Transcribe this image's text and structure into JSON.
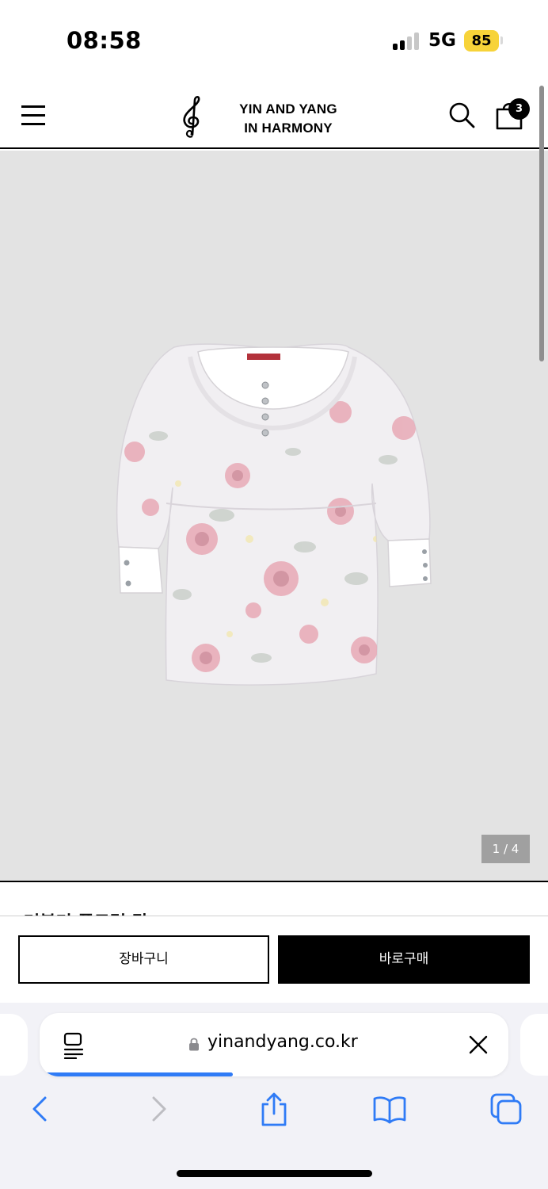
{
  "status_bar": {
    "time": "08:58",
    "network": "5G",
    "battery": "85",
    "battery_color": "#f7d339"
  },
  "header": {
    "menu_icon": "hamburger-icon",
    "logo_line1": "YIN AND YANG",
    "logo_line2": "IN HARMONY",
    "logo_icon": "treble-clef-icon",
    "search_icon": "search-icon",
    "cart_icon": "shopping-bag-icon",
    "cart_count": "3"
  },
  "gallery": {
    "background": "#e3e3e3",
    "image": "floral-print-top",
    "pager": "1 / 4"
  },
  "product": {
    "title_peek": "러블리 플로럴 탑"
  },
  "actions": {
    "cart_label": "장바구니",
    "buy_label": "바로구매"
  },
  "browser": {
    "url": "yinandyang.co.kr",
    "reader_icon": "reader-mode-icon",
    "lock_icon": "lock-icon",
    "close_icon": "close-icon",
    "load_progress": 0.41,
    "accent": "#2f7bf6",
    "nav": {
      "back_icon": "back-icon",
      "forward_icon": "forward-icon",
      "share_icon": "share-icon",
      "bookmarks_icon": "bookmarks-icon",
      "tabs_icon": "tabs-icon"
    }
  }
}
